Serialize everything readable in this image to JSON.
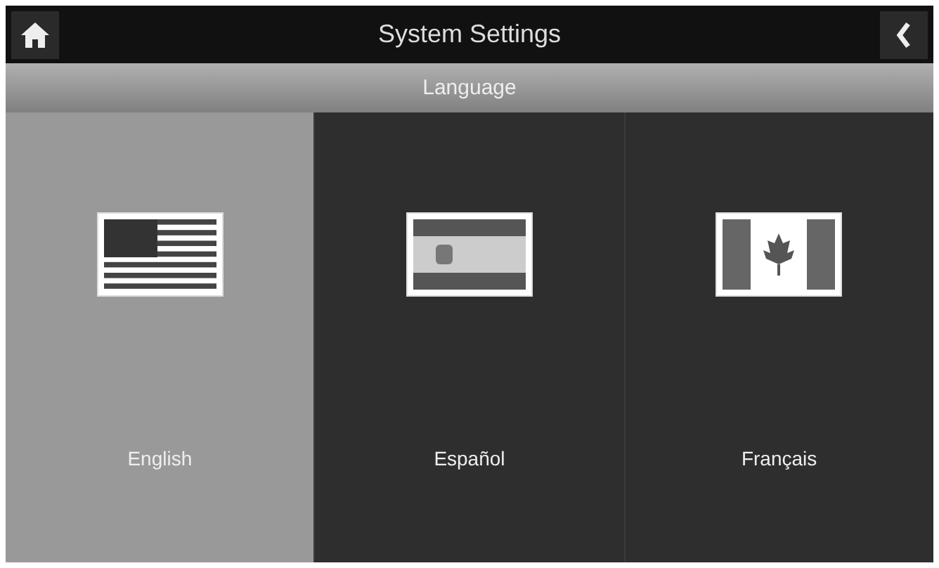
{
  "header": {
    "title": "System Settings"
  },
  "section": {
    "title": "Language"
  },
  "languages": [
    {
      "label": "English",
      "kind": "us",
      "selected": true
    },
    {
      "label": "Español",
      "kind": "es",
      "selected": false
    },
    {
      "label": "Français",
      "kind": "ca",
      "selected": false
    }
  ]
}
